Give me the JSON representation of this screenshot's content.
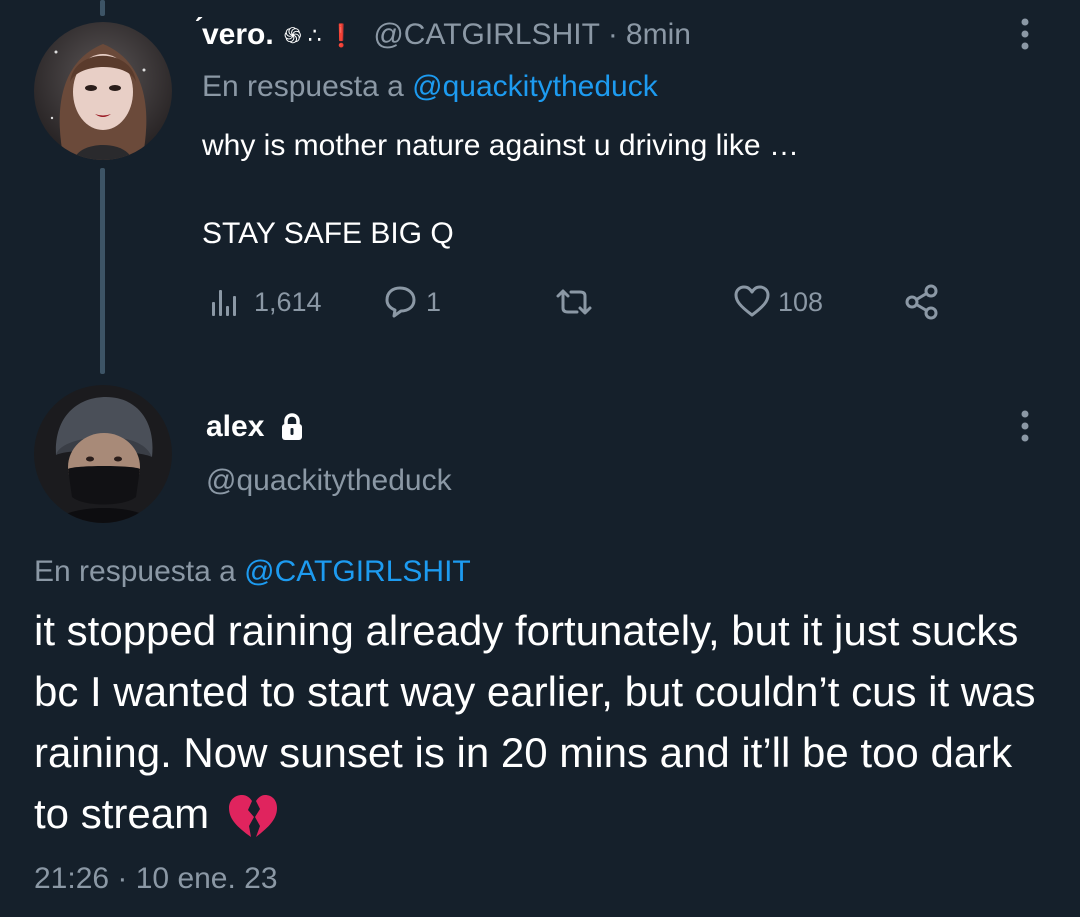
{
  "tweet_parent": {
    "display_name": "́vero.",
    "name_emojis": "֍ ∴ ❗",
    "handle": "@CATGIRLSHIT",
    "separator": "·",
    "time_ago": "8min",
    "reply_prefix": "En respuesta a",
    "reply_to": "@quackitytheduck",
    "text_line1": "why is mother nature against u driving like …",
    "text_line2": "STAY SAFE BIG Q",
    "views": "1,614",
    "replies": "1",
    "retweets": "",
    "likes": "108"
  },
  "tweet_main": {
    "display_name": "alex",
    "handle": "@quackitytheduck",
    "reply_prefix": "En respuesta a",
    "reply_to": "@CATGIRLSHIT",
    "text": "it stopped raining already fortunately, but it just sucks bc I wanted to start way earlier, but couldn’t cus it was raining. Now sunset is in 20 mins and it’ll be too dark to stream",
    "timestamp": "21:26 · 10 ene. 23"
  },
  "colors": {
    "background": "#15202b",
    "text_primary": "#ffffff",
    "text_muted": "#8b98a5",
    "link": "#1d9bf0",
    "thread_line": "#3d5466",
    "broken_heart": "#e0245e"
  },
  "icons": {
    "views": "bar-chart-icon",
    "reply": "speech-bubble-icon",
    "retweet": "retweet-arrows-icon",
    "like": "heart-outline-icon",
    "share": "share-nodes-icon",
    "more": "vertical-dots-icon",
    "lock": "lock-icon",
    "emoji": "broken-heart-emoji"
  }
}
